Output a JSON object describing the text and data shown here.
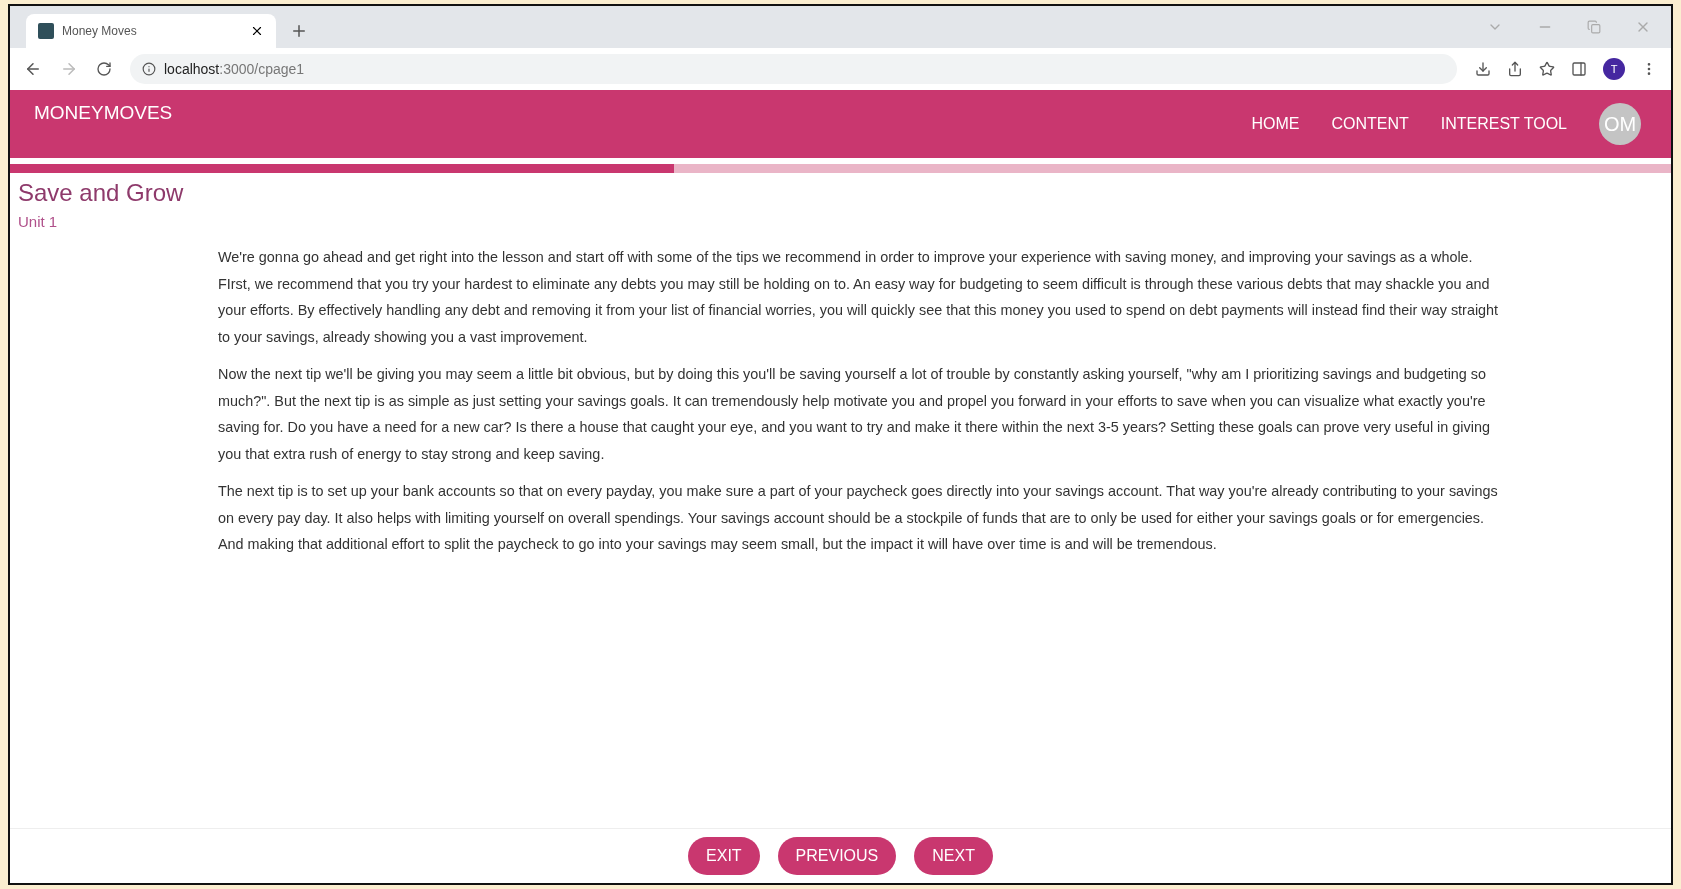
{
  "browser": {
    "tab_title": "Money Moves",
    "url_host": "localhost",
    "url_path": ":3000/cpage1",
    "profile_initial": "T"
  },
  "header": {
    "brand": "MONEYMOVES",
    "nav": [
      {
        "label": "HOME"
      },
      {
        "label": "CONTENT"
      },
      {
        "label": "INTEREST TOOL"
      }
    ],
    "avatar": "OM"
  },
  "progress": {
    "level": 0.4
  },
  "lesson": {
    "title": "Save and Grow",
    "unit": "Unit 1",
    "paragraphs": [
      "We're gonna go ahead and get right into the lesson and start off with some of the tips we recommend in order to improve your experience with saving money, and improving your savings as a whole. FIrst, we recommend that you try your hardest to eliminate any debts you may still be holding on to. An easy way for budgeting to seem difficult is through these various debts that may shackle you and your efforts. By effectively handling any debt and removing it from your list of financial worries, you will quickly see that this money you used to spend on debt payments will instead find their way straight to your savings, already showing you a vast improvement.",
      "Now the next tip we'll be giving you may seem a little bit obvious, but by doing this you'll be saving yourself a lot of trouble by constantly asking yourself, \"why am I prioritizing savings and budgeting so much?\". But the next tip is as simple as just setting your savings goals. It can tremendously help motivate you and propel you forward in your efforts to save when you can visualize what exactly you're saving for. Do you have a need for a new car? Is there a house that caught your eye, and you want to try and make it there within the next 3-5 years? Setting these goals can prove very useful in giving you that extra rush of energy to stay strong and keep saving.",
      "The next tip is to set up your bank accounts so that on every payday, you make sure a part of your paycheck goes directly into your savings account. That way you're already contributing to your savings on every pay day. It also helps with limiting yourself on overall spendings. Your savings account should be a stockpile of funds that are to only be used for either your savings goals or for emergencies. And making that additional effort to split the paycheck to go into your savings may seem small, but the impact it will have over time is and will be tremendous."
    ]
  },
  "footer_buttons": [
    {
      "label": "EXIT"
    },
    {
      "label": "PREVIOUS"
    },
    {
      "label": "NEXT"
    }
  ]
}
